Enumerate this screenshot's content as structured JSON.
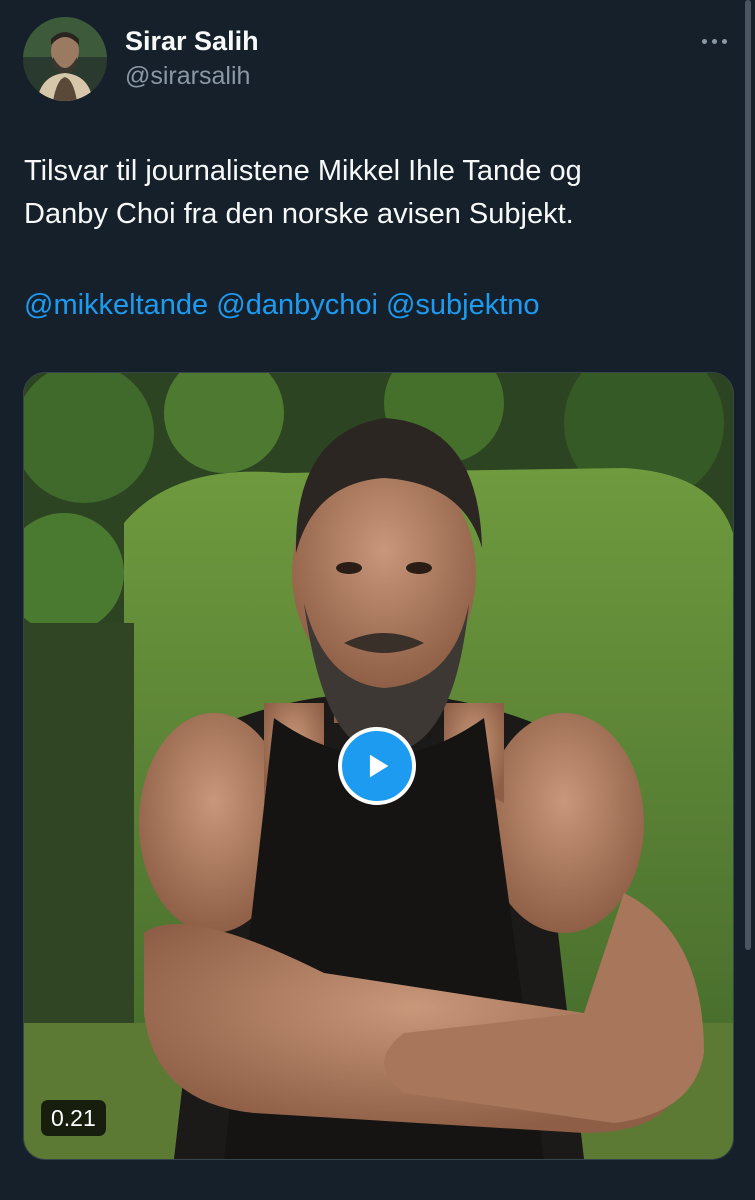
{
  "author": {
    "display_name": "Sirar Salih",
    "handle": "@sirarsalih"
  },
  "tweet": {
    "text_line1": "Tilsvar til journalistene Mikkel Ihle Tande og",
    "text_line2": "Danby Choi fra den norske avisen Subjekt.",
    "mentions": [
      "@mikkeltande",
      "@danbychoi",
      "@subjektno"
    ]
  },
  "video": {
    "duration": "0.21"
  },
  "icons": {
    "more": "more-horizontal-icon",
    "play": "play-icon"
  },
  "colors": {
    "background": "#15202b",
    "text": "#f7f9f9",
    "secondary_text": "#8b98a5",
    "accent": "#1d9bf0"
  }
}
